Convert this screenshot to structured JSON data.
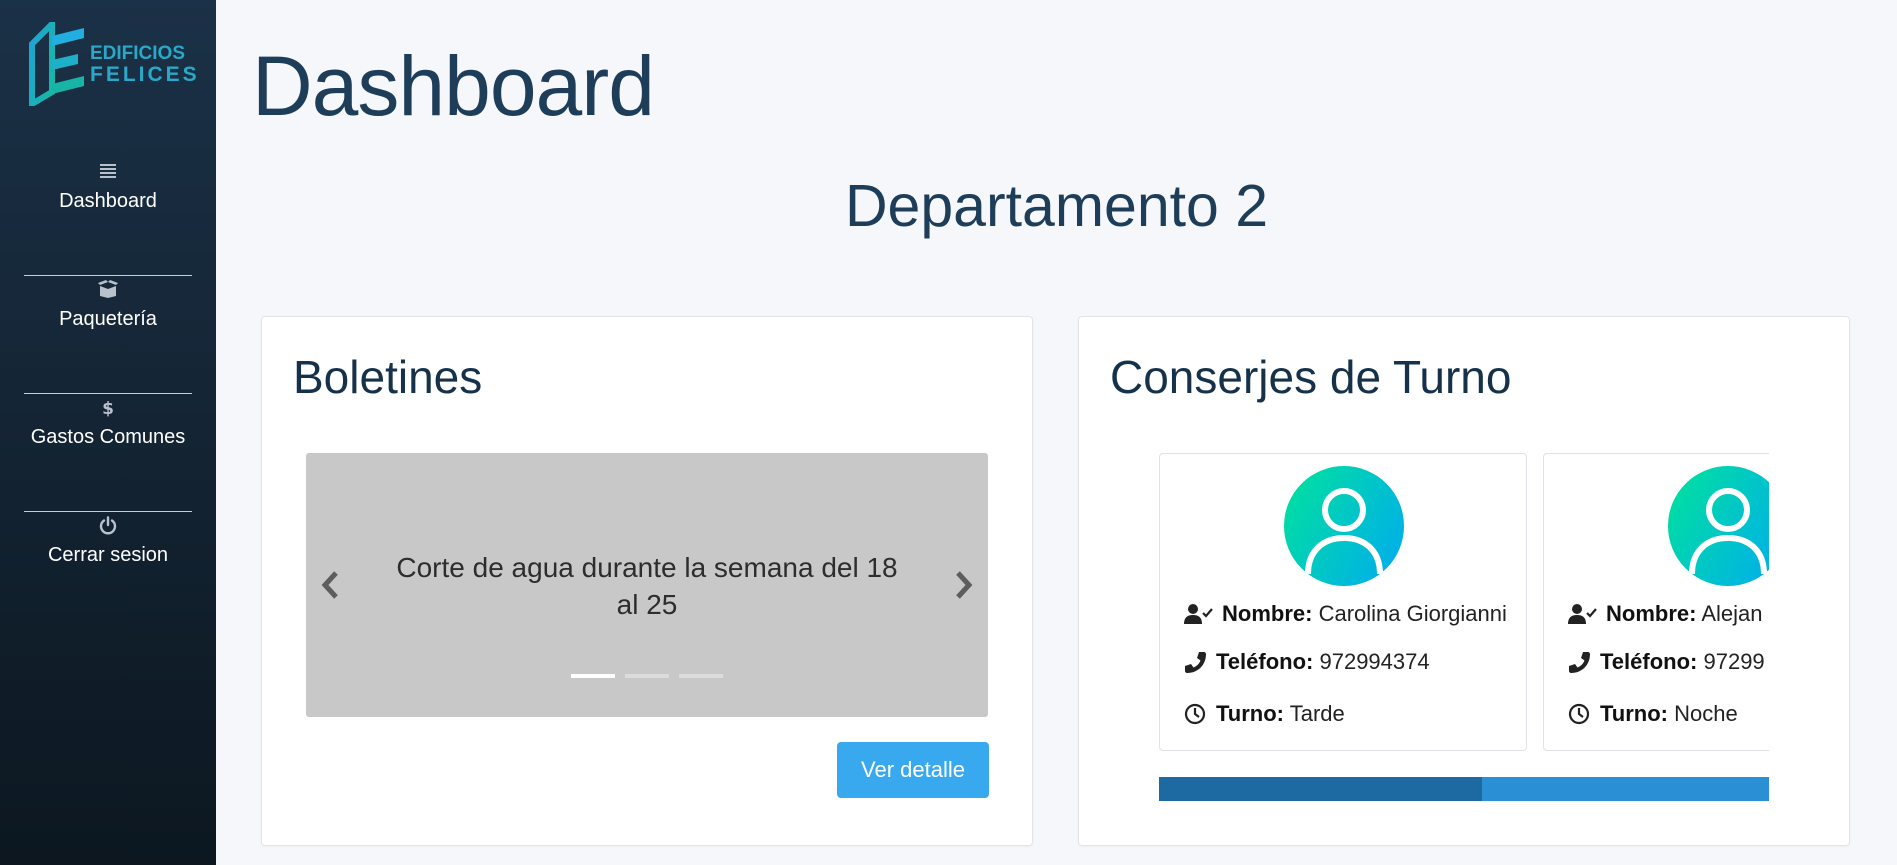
{
  "sidebar": {
    "logo_line1": "EDIFICIOS",
    "logo_line2": "FELICES",
    "items": [
      {
        "label": "Dashboard",
        "icon": "list-icon"
      },
      {
        "label": "Paquetería",
        "icon": "box-icon"
      },
      {
        "label": "Gastos Comunes",
        "icon": "dollar-icon"
      },
      {
        "label": "Cerrar sesion",
        "icon": "power-icon"
      }
    ]
  },
  "header": {
    "title": "Dashboard",
    "department": "Departamento 2"
  },
  "boletines": {
    "title": "Boletines",
    "slide_text": "Corte de agua durante la semana del 18 al 25",
    "active_slide": 1,
    "slide_count": 3,
    "button_label": "Ver detalle"
  },
  "conserjes": {
    "title": "Conserjes de Turno",
    "labels": {
      "name": "Nombre:",
      "phone": "Teléfono:",
      "shift": "Turno:"
    },
    "cards": [
      {
        "name": "Carolina Giorgianni",
        "phone": "972994374",
        "shift": "Tarde"
      },
      {
        "name": "Alejan",
        "phone": "97299",
        "shift": "Noche"
      }
    ],
    "scroll_position": 0.53
  },
  "colors": {
    "sidebar_top": "#1b3147",
    "sidebar_bottom": "#0c1720",
    "heading": "#1e3d58",
    "button": "#39a9ef",
    "avatar_start": "#00e39a",
    "avatar_end": "#00aaf2",
    "scroll_track": "#2b8fd5",
    "scroll_thumb": "#1d6aa2"
  }
}
